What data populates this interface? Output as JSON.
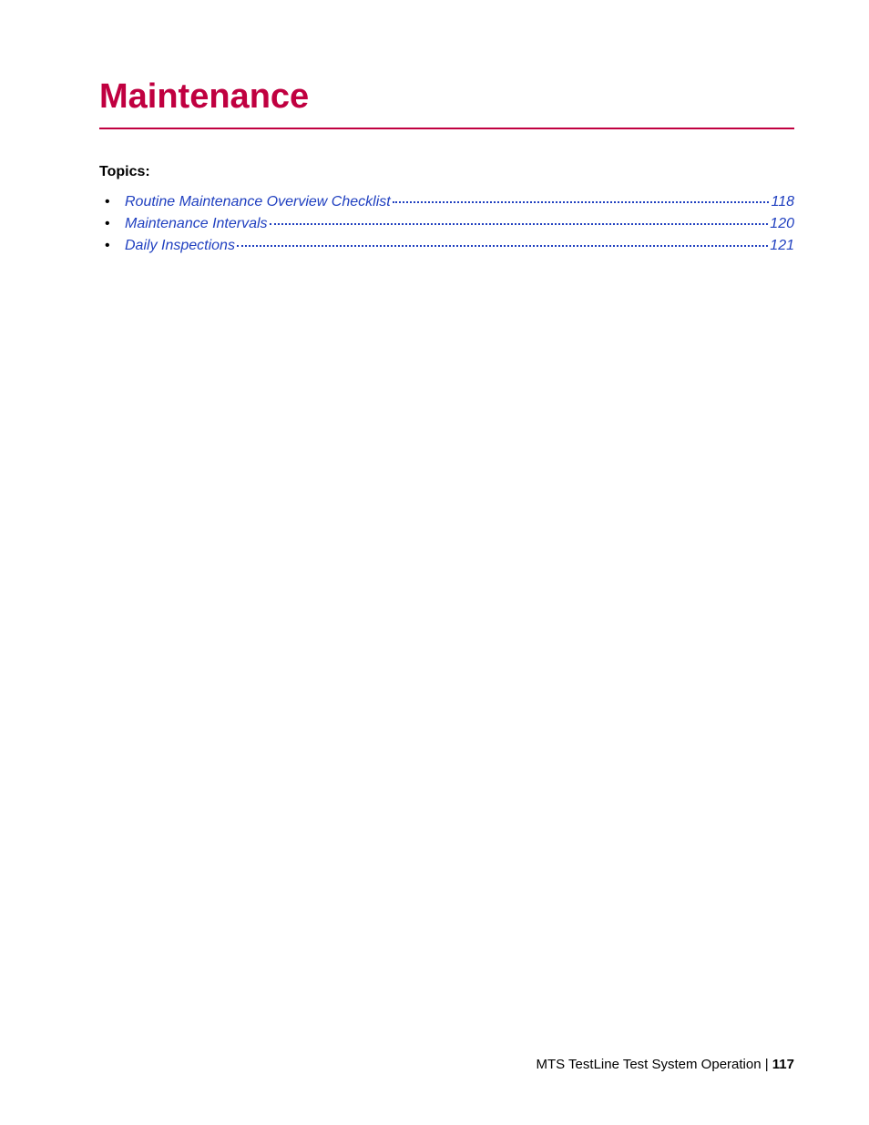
{
  "chapter": {
    "title": "Maintenance",
    "topics_label": "Topics:"
  },
  "toc": {
    "items": [
      {
        "title": "Routine Maintenance Overview Checklist",
        "page": "118"
      },
      {
        "title": "Maintenance  Intervals",
        "page": "120"
      },
      {
        "title": "Daily  Inspections",
        "page": "121"
      }
    ]
  },
  "footer": {
    "text": "MTS TestLine Test System Operation | ",
    "page": "117"
  }
}
